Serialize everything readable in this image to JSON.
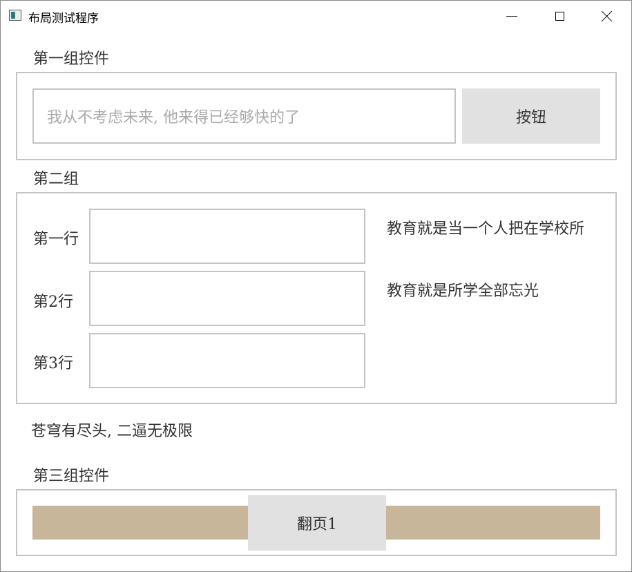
{
  "window": {
    "title": "布局测试程序",
    "controls": {
      "minimize": "minimize-icon",
      "maximize": "maximize-icon",
      "close": "close-icon"
    }
  },
  "group1": {
    "title": "第一组控件",
    "input_placeholder": "我从不考虑未来, 他来得已经够快的了",
    "button_label": "按钮"
  },
  "group2": {
    "title": "第二组",
    "rows": [
      {
        "label": "第一行",
        "value": ""
      },
      {
        "label": "第2行",
        "value": ""
      },
      {
        "label": "第3行",
        "value": ""
      }
    ],
    "quotes": [
      "教育就是当一个人把在学校所",
      "教育就是所学全部忘光"
    ]
  },
  "standalone_text": "苍穹有尽头, 二逼无极限",
  "group3": {
    "title": "第三组控件",
    "page_button_label": "翻页1",
    "bar_color": "#c7b699"
  }
}
